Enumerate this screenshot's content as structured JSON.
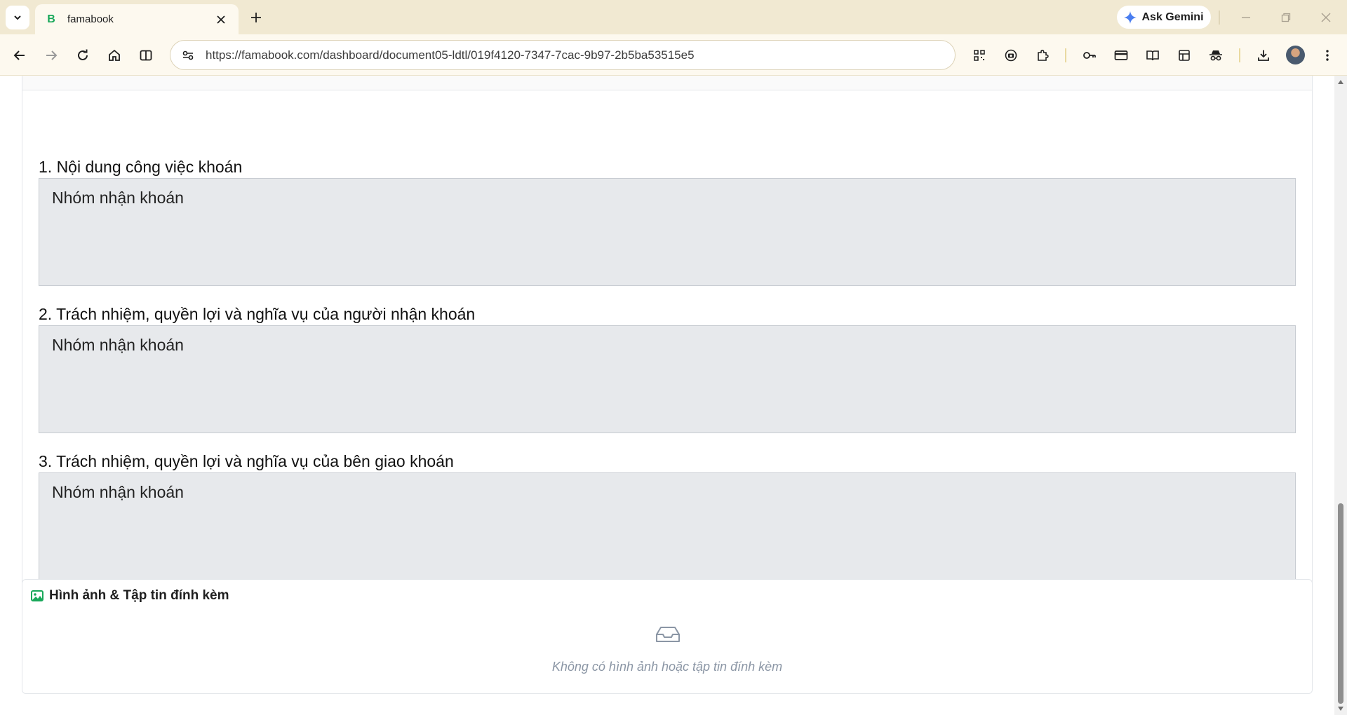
{
  "browser": {
    "tab": {
      "title": "famabook",
      "favicon": "B"
    },
    "gemini_label": "Ask Gemini",
    "url": "https://famabook.com/dashboard/document05-ldtl/019f4120-7347-7cac-9b97-2b5ba53515e5"
  },
  "sections": [
    {
      "label": "1. Nội dung công việc khoán",
      "value": "Nhóm nhận khoán"
    },
    {
      "label": "2. Trách nhiệm, quyền lợi và nghĩa vụ của người nhận khoán",
      "value": "Nhóm nhận khoán"
    },
    {
      "label": "3. Trách nhiệm, quyền lợi và nghĩa vụ của bên giao khoán",
      "value": "Nhóm nhận khoán"
    }
  ],
  "attachments": {
    "title": "Hình ảnh & Tập tin đính kèm",
    "empty_text": "Không có hình ảnh hoặc tập tin đính kèm"
  },
  "colors": {
    "chrome_bg": "#f1e9d2",
    "field_bg": "#e7e9ec",
    "attach_icon": "#19a85a"
  }
}
